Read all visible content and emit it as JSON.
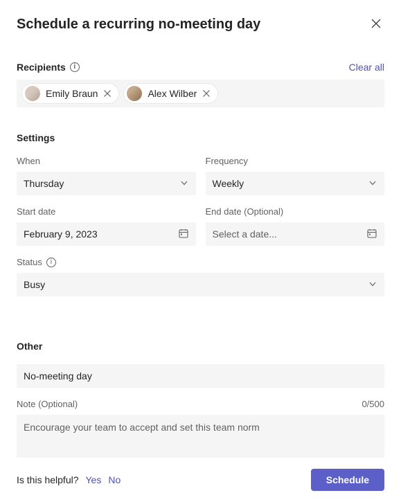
{
  "header": {
    "title": "Schedule a recurring no-meeting day"
  },
  "recipients": {
    "heading": "Recipients",
    "clear_all": "Clear all",
    "items": [
      {
        "name": "Emily Braun",
        "avatar_bg": "linear-gradient(135deg,#d6c9bf 40%,#b8a393 100%)"
      },
      {
        "name": "Alex Wilber",
        "avatar_bg": "linear-gradient(135deg,#c4a98e 30%,#8f6e4a 100%)"
      }
    ]
  },
  "settings": {
    "heading": "Settings",
    "when": {
      "label": "When",
      "value": "Thursday"
    },
    "frequency": {
      "label": "Frequency",
      "value": "Weekly"
    },
    "start_date": {
      "label": "Start date",
      "value": "February 9, 2023"
    },
    "end_date": {
      "label": "End date (Optional)",
      "placeholder": "Select a date..."
    },
    "status": {
      "label": "Status",
      "value": "Busy"
    }
  },
  "other": {
    "heading": "Other",
    "title_value": "No-meeting day",
    "note_label": "Note (Optional)",
    "note_counter": "0/500",
    "note_placeholder": "Encourage your team to accept and set this team norm"
  },
  "footer": {
    "helpful_prompt": "Is this helpful?",
    "yes": "Yes",
    "no": "No",
    "schedule": "Schedule"
  }
}
